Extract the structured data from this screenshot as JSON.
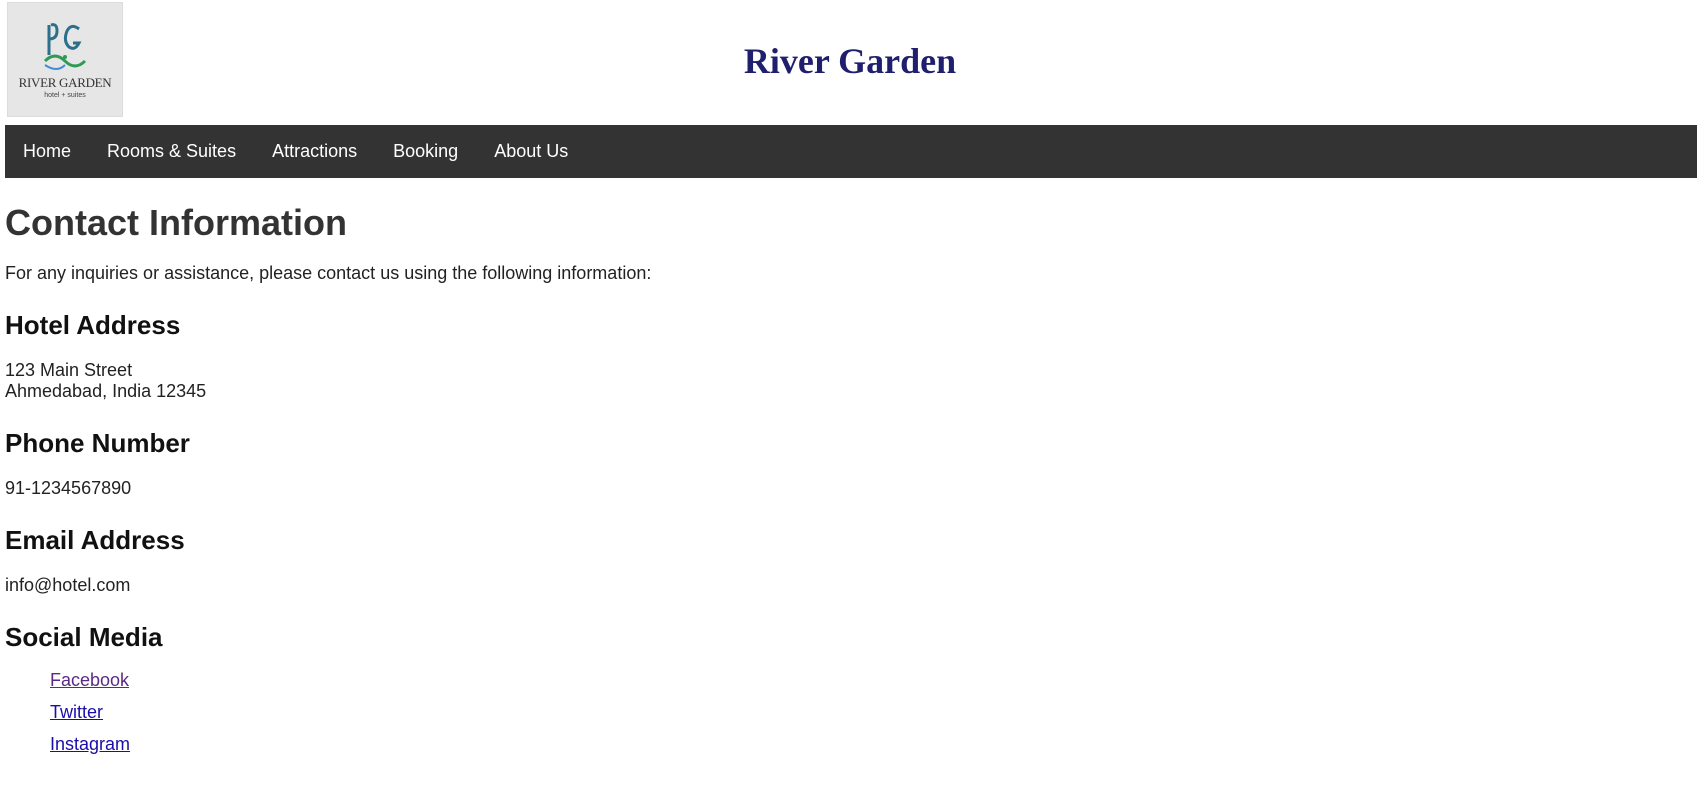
{
  "header": {
    "logo": {
      "icon": "river-garden-monogram",
      "wordmark": "RIVER GARDEN",
      "tagline": "hotel + suites"
    },
    "site_title": "River Garden"
  },
  "nav": {
    "items": [
      {
        "label": "Home"
      },
      {
        "label": "Rooms & Suites"
      },
      {
        "label": "Attractions"
      },
      {
        "label": "Booking"
      },
      {
        "label": "About Us"
      }
    ]
  },
  "main": {
    "heading": "Contact Information",
    "intro": "For any inquiries or assistance, please contact us using the following information:",
    "address": {
      "heading": "Hotel Address",
      "line1": "123 Main Street",
      "line2": "Ahmedabad, India 12345"
    },
    "phone": {
      "heading": "Phone Number",
      "value": "91-1234567890"
    },
    "email": {
      "heading": "Email Address",
      "value": "info@hotel.com"
    },
    "social": {
      "heading": "Social Media",
      "links": [
        {
          "label": "Facebook",
          "visited": true
        },
        {
          "label": "Twitter",
          "visited": false
        },
        {
          "label": "Instagram",
          "visited": false
        }
      ]
    }
  },
  "colors": {
    "title": "#1f1f6e",
    "navbar_bg": "#333333",
    "link": "#1a0dab",
    "visited_link": "#5b2a86"
  }
}
